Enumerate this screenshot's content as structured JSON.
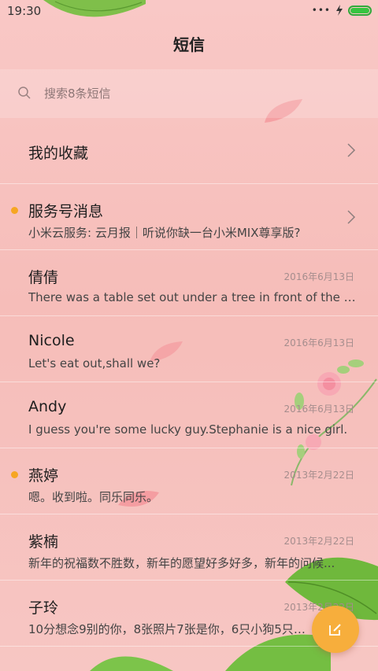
{
  "status_bar": {
    "time": "19:30",
    "signal": "•••"
  },
  "header": {
    "title": "短信"
  },
  "search": {
    "placeholder": "搜索8条短信",
    "value": ""
  },
  "favorites": {
    "label": "我的收藏"
  },
  "service": {
    "title": "服务号消息",
    "preview": "小米云服务: 云月报｜听说你缺一台小米MIX尊享版?",
    "unread": true
  },
  "conversations": [
    {
      "name": "倩倩",
      "date": "2016年6月13日",
      "preview": "There was a table set out under a tree in front of the ho...",
      "unread": false
    },
    {
      "name": "Nicole",
      "date": "2016年6月13日",
      "preview": "Let's eat out,shall we?",
      "unread": false
    },
    {
      "name": "Andy",
      "date": "2016年6月13日",
      "preview": "I guess you're some lucky guy.Stephanie is a nice girl.",
      "unread": false
    },
    {
      "name": "燕婷",
      "date": "2013年2月22日",
      "preview": "嗯。收到啦。同乐同乐。",
      "unread": true
    },
    {
      "name": "紫楠",
      "date": "2013年2月22日",
      "preview": "新年的祝福数不胜数，新年的愿望好多好多，新年的问候...",
      "unread": false
    },
    {
      "name": "子玲",
      "date": "2013年2月22日",
      "preview": "10分想念9别的你，8张照片7张是你，6只小狗5只像你...",
      "unread": false
    }
  ],
  "colors": {
    "accent": "#f7ae3c",
    "unread": "#f6a623",
    "battery": "#36c43f",
    "background": "#f8c3c0"
  },
  "icons": {
    "search": "search-icon",
    "chevron": "chevron-right-icon",
    "compose": "compose-icon",
    "battery": "battery-icon",
    "charge": "charge-icon"
  }
}
